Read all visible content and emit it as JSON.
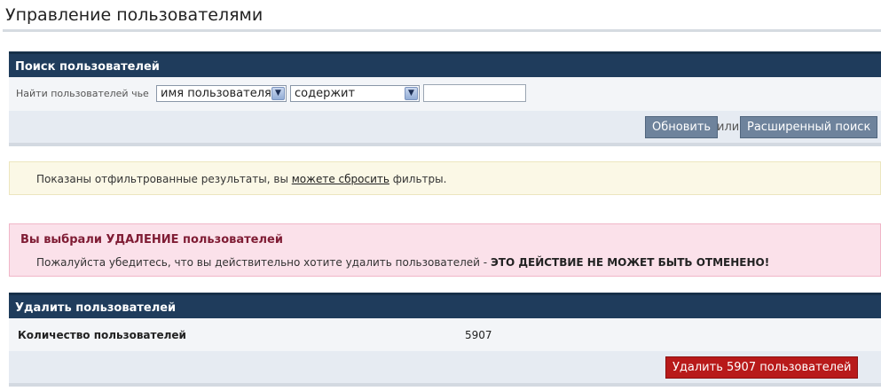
{
  "page": {
    "title": "Управление пользователями"
  },
  "search_panel": {
    "header": "Поиск пользователей",
    "label": "Найти пользователей чье",
    "field_select": "имя пользователя",
    "operator_select": "содержит",
    "input_value": "",
    "refresh_button": "Обновить",
    "or_text": "или",
    "advanced_button": "Расширенный поиск"
  },
  "notice": {
    "text_before": "Показаны отфильтрованные результаты, вы ",
    "link": "можете сбросить",
    "text_after": " фильтры."
  },
  "warning": {
    "title": "Вы выбрали УДАЛЕНИЕ пользователей",
    "text": "Пожалуйста убедитесь, что вы действительно хотите удалить пользователей - ",
    "strong": "ЭТО ДЕЙСТВИЕ НЕ МОЖЕТ БЫТЬ ОТМЕНЕНО!"
  },
  "delete_panel": {
    "header": "Удалить пользователей",
    "count_label": "Количество пользователей",
    "count_value": "5907",
    "delete_button": "Удалить 5907 пользователей"
  },
  "colors": {
    "header_bg": "#1f3c5c",
    "button_bg": "#6e839c",
    "danger_button": "#b81a1a",
    "warning_bg": "#fbe1ea",
    "notice_bg": "#fbf8e6"
  },
  "icons": {
    "select_arrow": "chevron-down-icon"
  }
}
